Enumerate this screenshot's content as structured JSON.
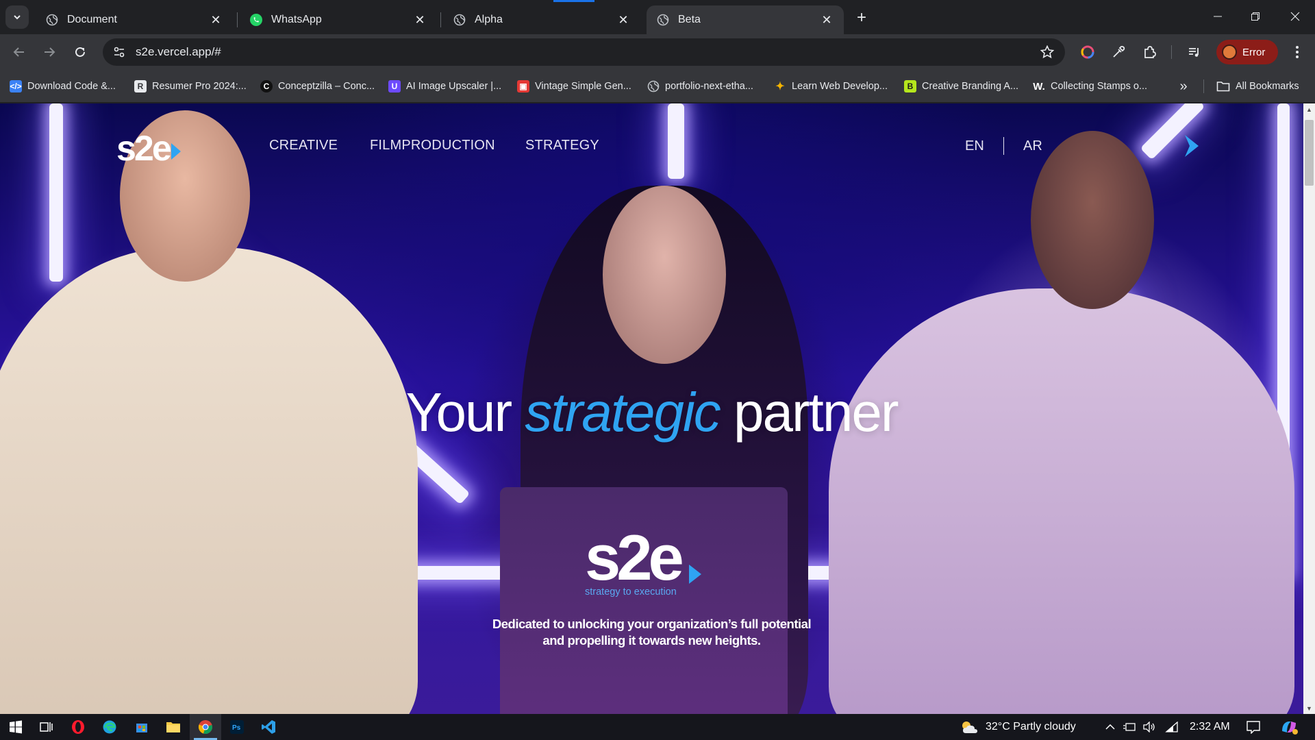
{
  "browser": {
    "tabs": [
      {
        "title": "Document",
        "icon": "globe-icon",
        "active": false
      },
      {
        "title": "WhatsApp",
        "icon": "whatsapp-icon",
        "active": false
      },
      {
        "title": "Alpha",
        "icon": "globe-icon",
        "active": false
      },
      {
        "title": "Beta",
        "icon": "globe-icon",
        "active": true
      }
    ],
    "url": "s2e.vercel.app/#",
    "profile_label": "Error",
    "bookmarks": [
      {
        "label": "Download Code &...",
        "icon": "code-icon",
        "color": "#3b82f6"
      },
      {
        "label": "Resumer Pro 2024:...",
        "icon": "resumer-icon",
        "color": "#e8eaed"
      },
      {
        "label": "Conceptzilla – Conc...",
        "icon": "conceptzilla-icon",
        "color": "#111111"
      },
      {
        "label": "AI Image Upscaler |...",
        "icon": "upscaler-icon",
        "color": "#6d4aff"
      },
      {
        "label": "Vintage Simple Gen...",
        "icon": "vintage-icon",
        "color": "#e53935"
      },
      {
        "label": "portfolio-next-etha...",
        "icon": "globe-icon",
        "color": "#9aa0a6"
      },
      {
        "label": "Learn Web Develop...",
        "icon": "learn-icon",
        "color": "#f4b400"
      },
      {
        "label": "Creative Branding A...",
        "icon": "branding-icon",
        "color": "#b5e61d"
      },
      {
        "label": "Collecting Stamps o...",
        "icon": "w-icon",
        "color": "#35363a"
      }
    ],
    "all_bookmarks_label": "All Bookmarks"
  },
  "site": {
    "logo": "s2e",
    "nav": [
      "CREATIVE",
      "FILMPRODUCTION",
      "STRATEGY"
    ],
    "languages": [
      "EN",
      "AR"
    ],
    "headline_pre": "Your",
    "headline_accent": "strategic",
    "headline_post": "partner",
    "center_logo": "s2e",
    "center_logo_tagline": "strategy to execution",
    "tagline_line1": "Dedicated to unlocking your organization’s full potential",
    "tagline_line2": "and propelling it towards new heights.",
    "accent_color": "#2fa4f2"
  },
  "taskbar": {
    "weather": "32°C  Partly cloudy",
    "time": "2:32 AM"
  }
}
